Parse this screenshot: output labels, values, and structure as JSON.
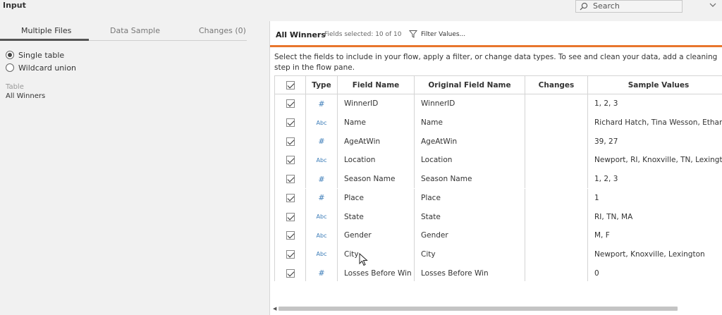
{
  "header": {
    "title": "Input",
    "search_placeholder": "Search"
  },
  "left": {
    "tabs": [
      {
        "label": "Multiple Files",
        "active": true
      },
      {
        "label": "Data Sample",
        "active": false
      },
      {
        "label": "Changes (0)",
        "active": false
      }
    ],
    "options": [
      {
        "label": "Single table",
        "selected": true
      },
      {
        "label": "Wildcard union",
        "selected": false
      }
    ],
    "table_caption": "Table",
    "table_name": "All Winners"
  },
  "right": {
    "title": "All Winners",
    "fields_selected": "Fields selected: 10 of 10",
    "filter_label": "Filter Values...",
    "instructions": "Select the fields to include in your flow, apply a filter, or change data types. To see and clean your data, add a cleaning step in the flow pane.",
    "columns": [
      "Type",
      "Field Name",
      "Original Field Name",
      "Changes",
      "Sample Values"
    ],
    "rows": [
      {
        "checked": true,
        "type": "number",
        "field": "WinnerID",
        "original": "WinnerID",
        "changes": "",
        "sample": "1, 2, 3"
      },
      {
        "checked": true,
        "type": "string",
        "field": "Name",
        "original": "Name",
        "changes": "",
        "sample": "Richard Hatch, Tina Wesson, Ethan Zo"
      },
      {
        "checked": true,
        "type": "number",
        "field": "AgeAtWin",
        "original": "AgeAtWin",
        "changes": "",
        "sample": "39, 27"
      },
      {
        "checked": true,
        "type": "string",
        "field": "Location",
        "original": "Location",
        "changes": "",
        "sample": "Newport, RI, Knoxville, TN, Lexington"
      },
      {
        "checked": true,
        "type": "number",
        "field": "Season Name",
        "original": "Season Name",
        "changes": "",
        "sample": "1, 2, 3"
      },
      {
        "checked": true,
        "type": "number",
        "field": "Place",
        "original": "Place",
        "changes": "",
        "sample": "1"
      },
      {
        "checked": true,
        "type": "string",
        "field": "State",
        "original": "State",
        "changes": "",
        "sample": "RI, TN, MA"
      },
      {
        "checked": true,
        "type": "string",
        "field": "Gender",
        "original": "Gender",
        "changes": "",
        "sample": "M, F"
      },
      {
        "checked": true,
        "type": "string",
        "field": "City",
        "original": "City",
        "changes": "",
        "sample": "Newport, Knoxville, Lexington"
      },
      {
        "checked": true,
        "type": "number",
        "field": "Losses Before Win",
        "original": "Losses Before Win",
        "changes": "",
        "sample": "0"
      }
    ],
    "type_glyphs": {
      "number": "#",
      "string": "Abc"
    }
  },
  "colors": {
    "accent": "#e8762d",
    "type_icon": "#3b7cb8"
  }
}
